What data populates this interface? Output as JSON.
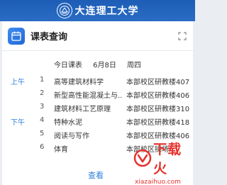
{
  "header": {
    "school_name": "大连理工大学"
  },
  "card": {
    "title": "课表查询"
  },
  "today": {
    "label": "今日课表",
    "date": "6月8日",
    "weekday": "周四"
  },
  "schedule": [
    {
      "period": "上午",
      "num": "1",
      "course": "高等建筑材料学",
      "location": "本部校区研教楼407"
    },
    {
      "period": "",
      "num": "2",
      "course": "新型高性能混凝土与...",
      "location": "本部校区研教楼406"
    },
    {
      "period": "",
      "num": "3",
      "course": "建筑材料工艺原理",
      "location": "本部校区研教楼310"
    },
    {
      "period": "下午",
      "num": "4",
      "course": "特种水泥",
      "location": "本部校区研教楼418"
    },
    {
      "period": "",
      "num": "5",
      "course": "阅读与写作",
      "location": "本部校区研教楼406"
    },
    {
      "period": "",
      "num": "6",
      "course": "体育",
      "location": "本部校区操场"
    }
  ],
  "view_link": "查看",
  "watermark": {
    "text": "下载火",
    "url": "xiazaihuo.com"
  },
  "colors": {
    "header_blue": "#1d5db6",
    "accent_blue": "#2f7fd9",
    "watermark_red": "#e5322d"
  },
  "icons": {
    "school_logo": "school-emblem-icon",
    "app": "calendar-icon",
    "expand": "expand-icon"
  }
}
